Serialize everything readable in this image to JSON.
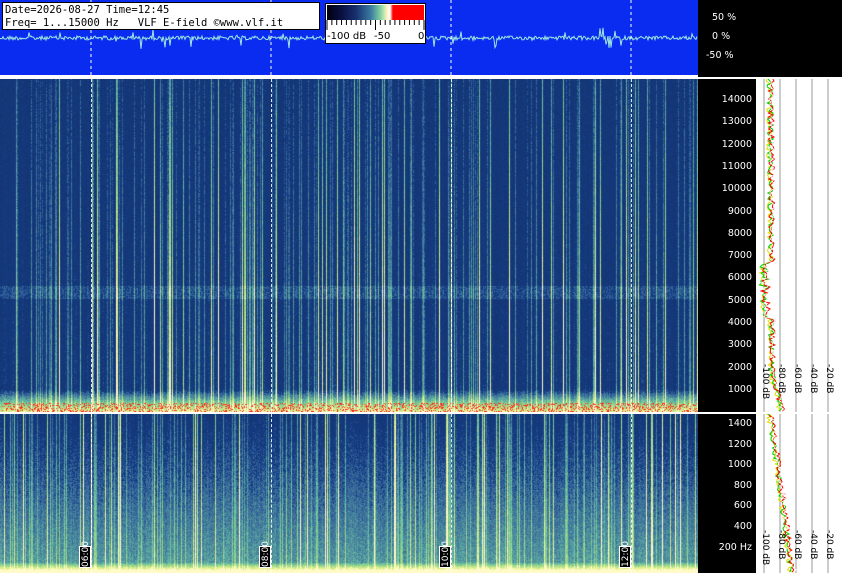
{
  "header": {
    "line1": "Date=2026-08-27 Time=12:45",
    "line2": "Freq= 1...15000 Hz   VLF E-field ©www.vlf.it"
  },
  "colorbar": {
    "labels": [
      "-100 dB",
      "-50",
      "0"
    ],
    "colors": [
      "#000010",
      "#183070",
      "#80d0a0",
      "#ffffff",
      "#ff0000"
    ]
  },
  "amplitude_scale": [
    "50 %",
    "0 %",
    "-50 %"
  ],
  "freq_axis_high": [
    "14000",
    "13000",
    "12000",
    "11000",
    "10000",
    "9000",
    "8000",
    "7000",
    "6000",
    "5000",
    "4000",
    "3000",
    "2000",
    "1000"
  ],
  "freq_axis_low": [
    "1400",
    "1200",
    "1000",
    "800",
    "600",
    "400",
    "200 Hz"
  ],
  "db_axis_high": [
    "-100 dB",
    "-80 dB",
    "-60 dB",
    "-40 dB",
    "-20 dB"
  ],
  "db_axis_low": [
    "-100 dB",
    "-80 dB",
    "-60 dB",
    "-40 dB",
    "-20 dB"
  ],
  "time_labels": [
    "06:00",
    "08:00",
    "10:00",
    "12:00"
  ],
  "colors": {
    "waveform_bg": "#0a2cf0",
    "spectrogram_bg": "#1a2b6e",
    "profile_red": "#ff0000",
    "profile_green": "#00cc00",
    "profile_yellow": "#e0e000"
  }
}
